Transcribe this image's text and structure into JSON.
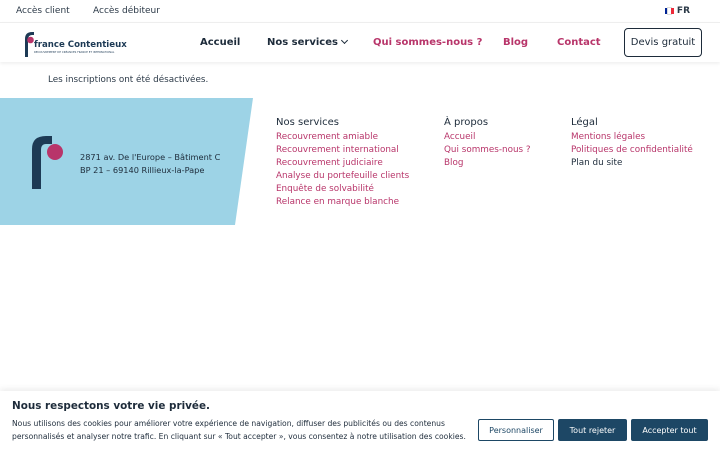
{
  "topbar": {
    "client_access": "Accès client",
    "debtor_access": "Accès débiteur",
    "language": "FR",
    "flag_colors": [
      "#002395",
      "#ffffff",
      "#ed2939"
    ]
  },
  "header": {
    "logo": {
      "name": "france Contentieux",
      "tagline": "RECOUVREMENT DE CRÉANCES FRANCE ET INTERNATIONAL"
    },
    "nav": {
      "home": "Accueil",
      "services": "Nos services",
      "about": "Qui sommes-nous ?",
      "blog": "Blog",
      "contact": "Contact"
    },
    "cta": "Devis gratuit"
  },
  "main": {
    "notice": "Les inscriptions ont été désactivées."
  },
  "footer": {
    "address_line1": "2871 av. De l'Europe – Bâtiment C",
    "address_line2": "BP 21 – 69140 Rillieux-la-Pape",
    "services": {
      "title": "Nos services",
      "items": [
        "Recouvrement amiable",
        "Recouvrement international",
        "Recouvrement judiciaire",
        "Analyse du portefeuille clients",
        "Enquête de solvabilité",
        "Relance en marque blanche"
      ]
    },
    "about": {
      "title": "À propos",
      "items": [
        "Accueil",
        "Qui sommes-nous ?",
        "Blog"
      ]
    },
    "legal": {
      "title": "Légal",
      "items": [
        "Mentions légales",
        "Politiques de confidentialité",
        "Plan du site"
      ]
    }
  },
  "cookie": {
    "title": "Nous respectons votre vie privée.",
    "text": "Nous utilisons des cookies pour améliorer votre expérience de navigation, diffuser des publicités ou des contenus personnalisés et analyser notre trafic. En cliquant sur « Tout accepter », vous consentez à notre utilisation des cookies.",
    "customize": "Personnaliser",
    "reject": "Tout rejeter",
    "accept": "Accepter tout"
  },
  "colors": {
    "accent_pink": "#b8356a",
    "navy": "#1d2b3a",
    "footer_blue": "#9dd3e6",
    "button_navy": "#1d4765"
  }
}
